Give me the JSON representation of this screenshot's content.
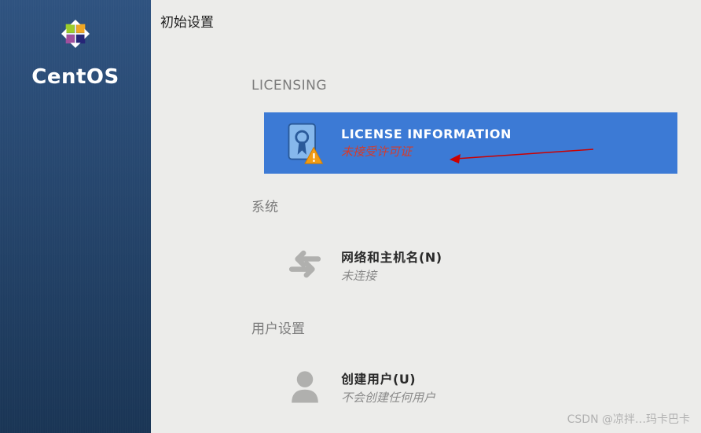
{
  "sidebar": {
    "brand": "CentOS"
  },
  "page": {
    "title": "初始设置"
  },
  "sections": {
    "licensing": {
      "header": "LICENSING",
      "item": {
        "title": "LICENSE INFORMATION",
        "status": "未接受许可证"
      }
    },
    "system": {
      "header": "系统",
      "item": {
        "title": "网络和主机名(N)",
        "status": "未连接"
      }
    },
    "user": {
      "header": "用户设置",
      "item": {
        "title": "创建用户(U)",
        "status": "不会创建任何用户"
      }
    }
  },
  "colors": {
    "highlight": "#3c7ad5",
    "warning": "#f39c12",
    "error_text": "#d43c2c",
    "muted": "#8a8a8a"
  },
  "watermark": "CSDN @凉拌…玛卡巴卡"
}
